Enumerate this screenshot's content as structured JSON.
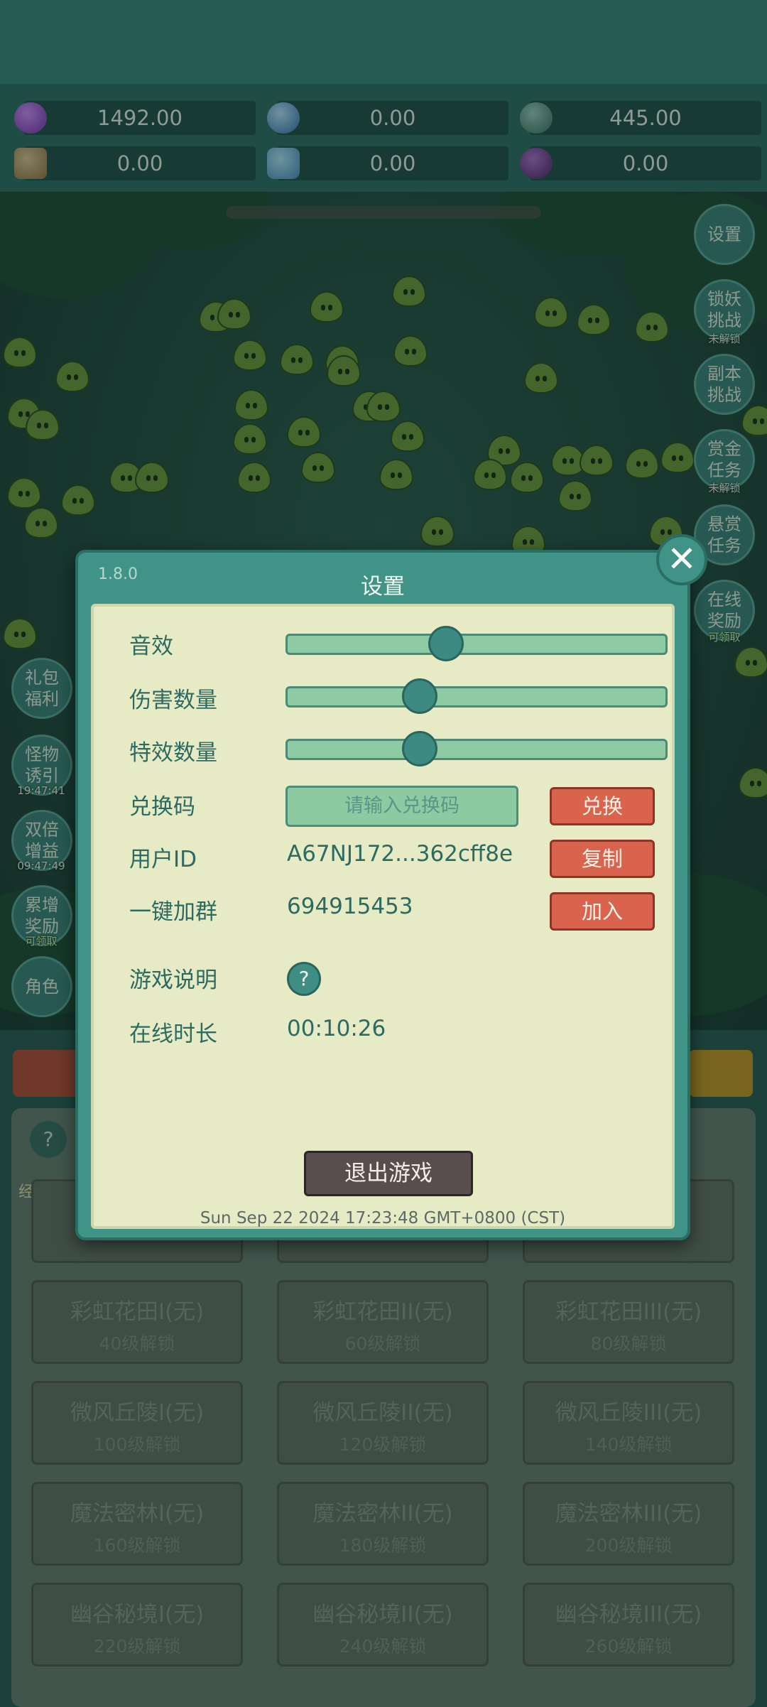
{
  "stats": [
    {
      "icon": "purple-gem-icon",
      "value": "1492.00"
    },
    {
      "icon": "blue-orb-icon",
      "value": "0.00"
    },
    {
      "icon": "grey-stone-icon",
      "value": "445.00"
    },
    {
      "icon": "scroll-icon",
      "value": "0.00"
    },
    {
      "icon": "crystal-icon",
      "value": "0.00"
    },
    {
      "icon": "purple-pot-icon",
      "value": "0.00"
    }
  ],
  "right_menu": [
    {
      "label": "设置",
      "sub": ""
    },
    {
      "label": "锁妖挑战",
      "sub": "未解锁"
    },
    {
      "label": "副本挑战",
      "sub": ""
    },
    {
      "label": "赏金任务",
      "sub": "未解锁"
    },
    {
      "label": "悬赏任务",
      "sub": ""
    },
    {
      "label": "在线奖励",
      "sub": "可领取"
    }
  ],
  "left_menu": [
    {
      "label": "礼包福利",
      "sub": ""
    },
    {
      "label": "怪物诱引",
      "sub": "19:47:41"
    },
    {
      "label": "双倍增益",
      "sub": "09:47:49"
    },
    {
      "label": "累增奖励",
      "sub": "可领取"
    },
    {
      "label": "角色",
      "sub": ""
    }
  ],
  "bottom": {
    "help": "?",
    "exp_label": "经验",
    "tiles": [
      {
        "name": "彩虹花田I(无)",
        "sub": "40级解锁"
      },
      {
        "name": "彩虹花田II(无)",
        "sub": "60级解锁"
      },
      {
        "name": "彩虹花田III(无)",
        "sub": "80级解锁"
      },
      {
        "name": "微风丘陵I(无)",
        "sub": "100级解锁"
      },
      {
        "name": "微风丘陵II(无)",
        "sub": "120级解锁"
      },
      {
        "name": "微风丘陵III(无)",
        "sub": "140级解锁"
      },
      {
        "name": "魔法密林I(无)",
        "sub": "160级解锁"
      },
      {
        "name": "魔法密林II(无)",
        "sub": "180级解锁"
      },
      {
        "name": "魔法密林III(无)",
        "sub": "200级解锁"
      },
      {
        "name": "幽谷秘境I(无)",
        "sub": "220级解锁"
      },
      {
        "name": "幽谷秘境II(无)",
        "sub": "240级解锁"
      },
      {
        "name": "幽谷秘境III(无)",
        "sub": "260级解锁"
      }
    ]
  },
  "settings": {
    "version": "1.8.0",
    "title": "设置",
    "sound_label": "音效",
    "sound_level": 0.42,
    "damage_label": "伤害数量",
    "damage_level": 0.35,
    "effects_label": "特效数量",
    "effects_level": 0.35,
    "redeem_label": "兑换码",
    "redeem_placeholder": "请输入兑换码",
    "redeem_button": "兑换",
    "userid_label": "用户ID",
    "userid_value": "A67NJ172...362cff8e",
    "copy_button": "复制",
    "group_label": "一键加群",
    "group_value": "694915453",
    "join_button": "加入",
    "guide_label": "游戏说明",
    "guide_button": "?",
    "online_label": "在线时长",
    "online_value": "00:10:26",
    "exit_button": "退出游戏",
    "datetime": "Sun Sep 22 2024 17:23:48 GMT+0800 (CST)",
    "close_glyph": "✕"
  },
  "colors": {
    "accent_teal": "#3f9387",
    "panel_cream": "#e7ebc5",
    "button_red": "#d9634d",
    "exit_dark": "#5a4d4d"
  }
}
